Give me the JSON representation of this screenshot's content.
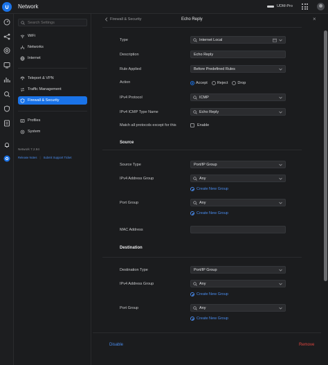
{
  "app": {
    "title": "Network",
    "device_name": "UDM-Pro"
  },
  "sidebar": {
    "search_placeholder": "Search Settings",
    "items": [
      {
        "label": "WiFi",
        "icon": "wifi-icon"
      },
      {
        "label": "Networks",
        "icon": "networks-icon"
      },
      {
        "label": "Internet",
        "icon": "globe-icon"
      },
      {
        "label": "Teleport & VPN",
        "icon": "teleport-icon"
      },
      {
        "label": "Traffic Management",
        "icon": "traffic-icon"
      },
      {
        "label": "Firewall & Security",
        "icon": "shield-icon",
        "active": true
      },
      {
        "label": "Profiles",
        "icon": "profiles-icon"
      },
      {
        "label": "System",
        "icon": "system-gear-icon"
      }
    ],
    "version": "Network 7.2.94",
    "links": [
      "Release Notes",
      "Submit Support Ticket"
    ]
  },
  "panel": {
    "breadcrumb": "Firewall & Security",
    "title": "Echo Reply",
    "fields": {
      "type": {
        "label": "Type",
        "value": "Internet Local"
      },
      "description": {
        "label": "Description",
        "value": "Echo Reply"
      },
      "rule_applied": {
        "label": "Rule Applied",
        "value": "Before Predefined Rules"
      },
      "action": {
        "label": "Action",
        "options": [
          "Accept",
          "Reject",
          "Drop"
        ],
        "selected": "Accept"
      },
      "ipv4_protocol": {
        "label": "IPv4 Protocol",
        "value": "ICMP"
      },
      "icmp_type": {
        "label": "IPv4 ICMP Type Name",
        "value": "Echo Reply"
      },
      "match_all": {
        "label": "Match all protocols except for this",
        "checkbox_label": "Enable"
      }
    },
    "source": {
      "heading": "Source",
      "source_type": {
        "label": "Source Type",
        "value": "Port/IP Group"
      },
      "ipv4_group": {
        "label": "IPv4 Address Group",
        "value": "Any"
      },
      "ipv4_create": "Create New Group",
      "port_group": {
        "label": "Port Group",
        "value": "Any"
      },
      "port_create": "Create New Group",
      "mac": {
        "label": "MAC Address",
        "value": ""
      }
    },
    "destination": {
      "heading": "Destination",
      "dest_type": {
        "label": "Destination Type",
        "value": "Port/IP Group"
      },
      "ipv4_group": {
        "label": "IPv4 Address Group",
        "value": "Any"
      },
      "ipv4_create": "Create New Group",
      "port_group": {
        "label": "Port Group",
        "value": "Any"
      },
      "port_create": "Create New Group"
    },
    "footer": {
      "disable": "Disable",
      "remove": "Remove"
    }
  },
  "colors": {
    "accent": "#1a73e8",
    "link": "#4a8df0",
    "danger": "#e0463f",
    "background": "#1a1b1d"
  }
}
